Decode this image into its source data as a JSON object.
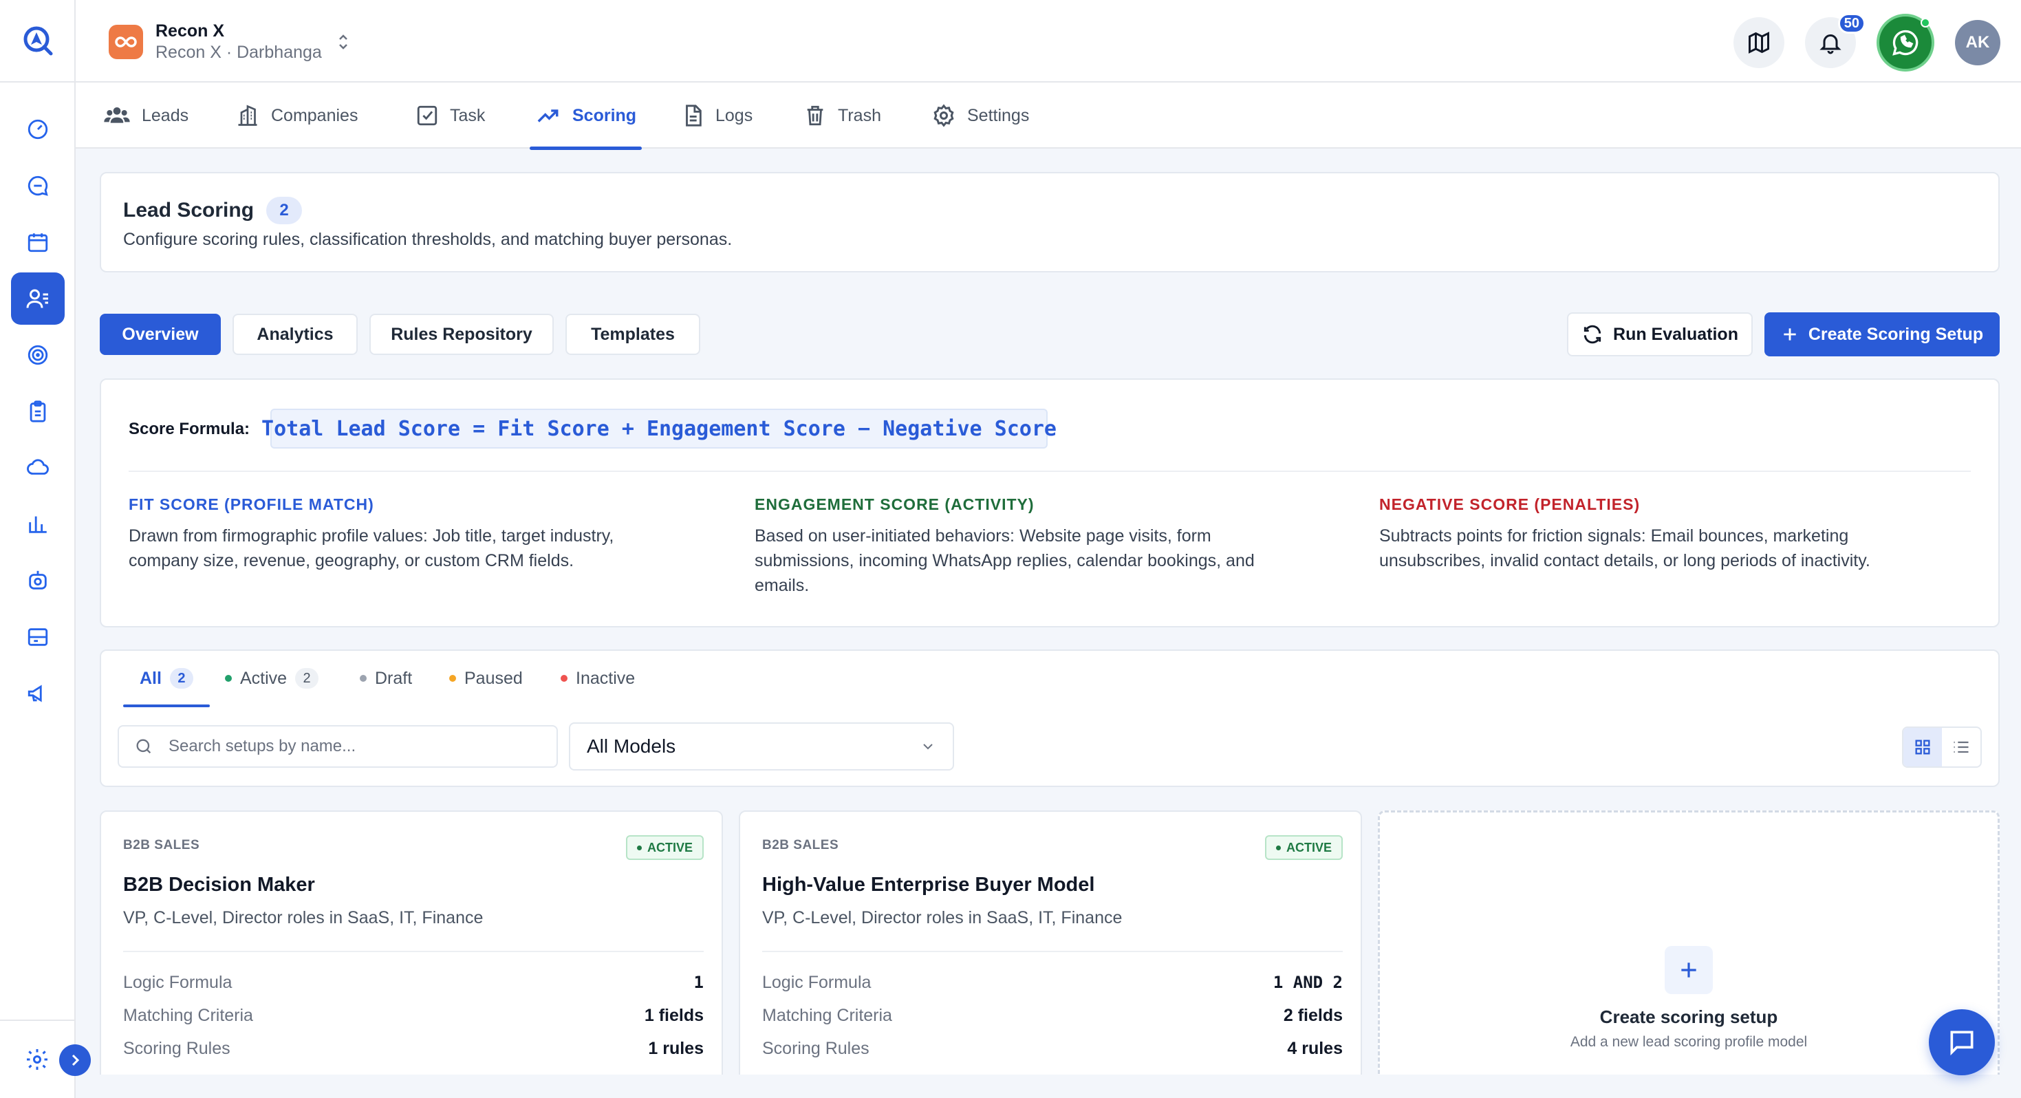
{
  "workspace": {
    "name": "Recon X",
    "subtitle": "Recon X · Darbhanga"
  },
  "topbar": {
    "notifications_count": "50",
    "avatar_initials": "AK"
  },
  "module_tabs": [
    {
      "label": "Leads",
      "icon": "users-icon"
    },
    {
      "label": "Companies",
      "icon": "building-icon"
    },
    {
      "label": "Task",
      "icon": "checkbox-icon"
    },
    {
      "label": "Scoring",
      "icon": "trending-up-icon",
      "active": true
    },
    {
      "label": "Logs",
      "icon": "file-icon"
    },
    {
      "label": "Trash",
      "icon": "trash-icon"
    },
    {
      "label": "Settings",
      "icon": "gear-icon"
    }
  ],
  "header": {
    "title": "Lead Scoring",
    "count": "2",
    "description": "Configure scoring rules, classification thresholds, and matching buyer personas."
  },
  "view_tabs": [
    "Overview",
    "Analytics",
    "Rules Repository",
    "Templates"
  ],
  "actions": {
    "run": "Run Evaluation",
    "create": "Create Scoring Setup"
  },
  "formula": {
    "label": "Score Formula:",
    "expression": "Total Lead Score = Fit Score + Engagement Score − Negative Score",
    "fit": {
      "heading": "FIT SCORE (PROFILE MATCH)",
      "text": "Drawn from firmographic profile values: Job title, target industry, company size, revenue, geography, or custom CRM fields."
    },
    "engagement": {
      "heading": "ENGAGEMENT SCORE (ACTIVITY)",
      "text": "Based on user-initiated behaviors: Website page visits, form submissions, incoming WhatsApp replies, calendar bookings, and emails."
    },
    "negative": {
      "heading": "NEGATIVE SCORE (PENALTIES)",
      "text": "Subtracts points for friction signals: Email bounces, marketing unsubscribes, invalid contact details, or long periods of inactivity."
    }
  },
  "status_tabs": [
    {
      "label": "All",
      "count": "2"
    },
    {
      "label": "Active",
      "count": "2",
      "dot": "#22a06b"
    },
    {
      "label": "Draft",
      "dot": "#9ca3af"
    },
    {
      "label": "Paused",
      "dot": "#f5a524"
    },
    {
      "label": "Inactive",
      "dot": "#ef5350"
    }
  ],
  "search": {
    "placeholder": "Search setups by name..."
  },
  "model_select": {
    "value": "All Models"
  },
  "setups": [
    {
      "category": "B2B SALES",
      "status": "ACTIVE",
      "name": "B2B Decision Maker",
      "description": "VP, C-Level, Director roles in SaaS, IT, Finance",
      "rows": [
        {
          "key": "Logic Formula",
          "value": "1"
        },
        {
          "key": "Matching Criteria",
          "value": "1 fields"
        },
        {
          "key": "Scoring Rules",
          "value": "1 rules"
        }
      ]
    },
    {
      "category": "B2B SALES",
      "status": "ACTIVE",
      "name": "High-Value Enterprise Buyer Model",
      "description": "VP, C-Level, Director roles in SaaS, IT, Finance",
      "rows": [
        {
          "key": "Logic Formula",
          "value": "1 AND 2"
        },
        {
          "key": "Matching Criteria",
          "value": "2 fields"
        },
        {
          "key": "Scoring Rules",
          "value": "4 rules"
        }
      ]
    }
  ],
  "new_setup": {
    "title": "Create scoring setup",
    "subtitle": "Add a new lead scoring profile model"
  }
}
